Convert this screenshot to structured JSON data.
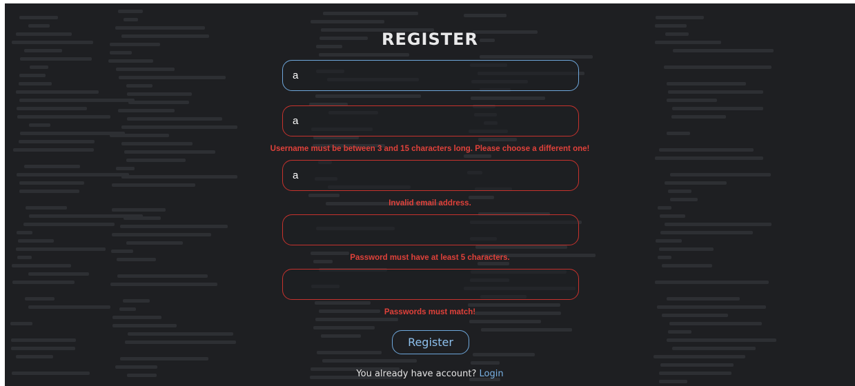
{
  "page": {
    "title": "REGISTER"
  },
  "form": {
    "field1_value": "a",
    "field2_value": "a",
    "field3_value": "a",
    "field4_value": "",
    "field5_value": "",
    "username_error": "Username must be between 3 and 15 characters long. Please choose a different one!",
    "email_error": "Invalid email address.",
    "password_error": "Password must have at least 5 characters.",
    "confirm_error": "Passwords must match!",
    "submit_label": "Register"
  },
  "footer": {
    "prompt": "You already have account?",
    "login_link": "Login"
  },
  "colors": {
    "background": "#1e1f22",
    "accent": "#6fa8dc",
    "error": "#e0413a"
  }
}
